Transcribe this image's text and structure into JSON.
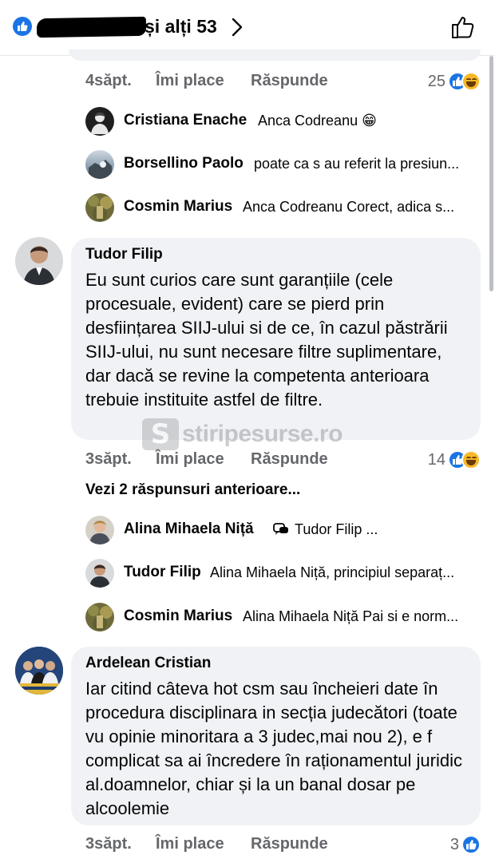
{
  "header": {
    "reactors_suffix": "și alți 53",
    "chevron_icon": "chevron-right-icon",
    "like_icon": "thumbs-up-outline-icon"
  },
  "colors": {
    "accent": "#1b74e4",
    "bubble": "#f0f2f5",
    "meta": "#65676b",
    "haha": "#f7b928"
  },
  "actions_labels": {
    "like": "Îmi place",
    "reply": "Răspunde"
  },
  "top_actions": {
    "time": "4săpt.",
    "count": "25"
  },
  "replies_group_1": [
    {
      "name": "Cristiana Enache",
      "text": "Anca Codreanu 😁"
    },
    {
      "name": "Borsellino Paolo",
      "text": "poate ca s au referit la presiun..."
    },
    {
      "name": "Cosmin Marius",
      "text": "Anca Codreanu Corect, adica s..."
    }
  ],
  "comment_1": {
    "author": "Tudor Filip",
    "text": "Eu sunt curios care sunt garanțiile (cele procesuale, evident) care se pierd prin desființarea SIIJ-ului si de ce, în cazul păstrării SIIJ-ului, nu sunt necesare filtre suplimentare, dar dacă se revine la competenta anterioara trebuie instituite astfel de filtre.",
    "time": "3săpt.",
    "count": "14"
  },
  "see_previous": "Vezi 2 răspunsuri anterioare...",
  "replies_group_2": [
    {
      "name": "Alina Mihaela Niță",
      "text": "Tudor Filip ..."
    },
    {
      "name": "Tudor Filip",
      "text": "Alina Mihaela Niță, principiul separaț..."
    },
    {
      "name": "Cosmin Marius",
      "text": "Alina Mihaela Niță Pai si e norm..."
    }
  ],
  "comment_2": {
    "author": "Ardelean Cristian",
    "text": "Iar citind câteva hot csm sau încheieri date în procedura disciplinara in secția judecători (toate vu opinie minoritara a 3 judec,mai nou 2), e f complicat sa ai încredere în raționamentul juridic al.doamnelor, chiar și la un banal dosar pe alcoolemie",
    "time": "3săpt.",
    "count": "3"
  },
  "watermark": {
    "letter": "S",
    "text": "stiripesurse.ro"
  }
}
